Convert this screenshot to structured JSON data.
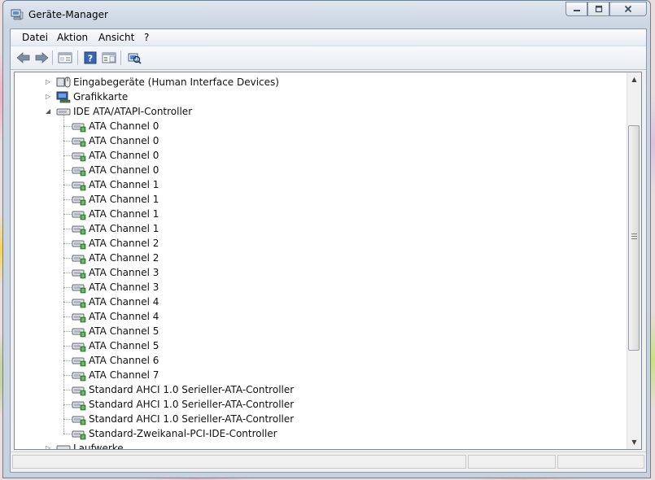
{
  "window": {
    "title": "Geräte-Manager"
  },
  "menu": {
    "items": [
      "Datei",
      "Aktion",
      "Ansicht",
      "?"
    ]
  },
  "toolbar": {
    "icons": [
      "back-arrow-icon",
      "forward-arrow-icon",
      "properties-icon",
      "help-icon",
      "console-tree-icon",
      "scan-hardware-icon"
    ]
  },
  "tree": {
    "categories": [
      {
        "label": "Eingabegeräte (Human Interface Devices)",
        "icon": "hid-icon",
        "expanded": false
      },
      {
        "label": "Grafikkarte",
        "icon": "display-adapter-icon",
        "expanded": false
      },
      {
        "label": "IDE ATA/ATAPI-Controller",
        "icon": "ide-controller-icon",
        "expanded": true
      }
    ],
    "children": [
      "ATA Channel 0",
      "ATA Channel 0",
      "ATA Channel 0",
      "ATA Channel 0",
      "ATA Channel 1",
      "ATA Channel 1",
      "ATA Channel 1",
      "ATA Channel 1",
      "ATA Channel 2",
      "ATA Channel 2",
      "ATA Channel 3",
      "ATA Channel 3",
      "ATA Channel 4",
      "ATA Channel 4",
      "ATA Channel 5",
      "ATA Channel 5",
      "ATA Channel 6",
      "ATA Channel 7",
      "Standard AHCI 1.0 Serieller-ATA-Controller",
      "Standard AHCI 1.0 Serieller-ATA-Controller",
      "Standard AHCI 1.0 Serieller-ATA-Controller",
      "Standard-Zweikanal-PCI-IDE-Controller"
    ],
    "partial_category": {
      "label": "Laufwerke",
      "icon": "disk-drive-icon",
      "expanded": false
    }
  }
}
